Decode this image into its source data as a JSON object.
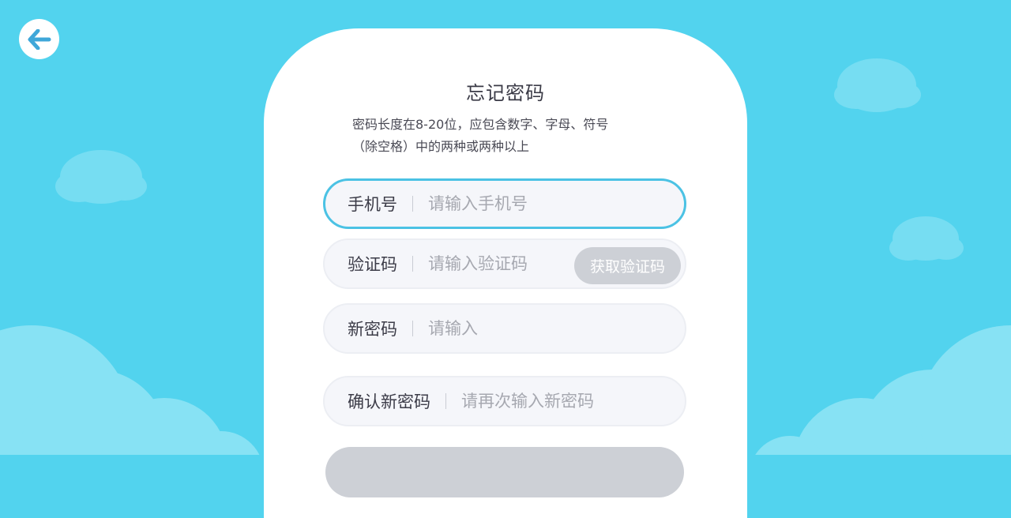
{
  "page": {
    "title": "忘记密码",
    "hint_lines": [
      "密码长度在8-20位，应包含数字、字母、符号",
      "（除空格）中的两种或两种以上"
    ]
  },
  "form": {
    "phone": {
      "label": "手机号",
      "placeholder": "请输入手机号"
    },
    "code": {
      "label": "验证码",
      "placeholder": "请输入验证码",
      "button_label": "获取验证码"
    },
    "new_password": {
      "label": "新密码",
      "placeholder": "请输入"
    },
    "confirm_password": {
      "label": "确认新密码",
      "placeholder": "请再次输入新密码"
    }
  },
  "colors": {
    "background": "#52d3ee",
    "active_border": "#4bc2e4",
    "back_arrow": "#3fa7d9",
    "disabled_button": "#cdd0d6"
  },
  "icons": {
    "back": "arrow-left-icon"
  }
}
